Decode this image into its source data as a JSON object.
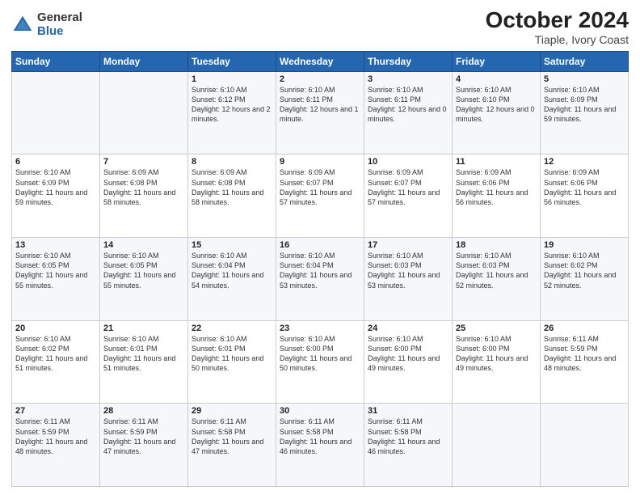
{
  "header": {
    "logo_general": "General",
    "logo_blue": "Blue",
    "title": "October 2024",
    "subtitle": "Tiaple, Ivory Coast"
  },
  "columns": [
    "Sunday",
    "Monday",
    "Tuesday",
    "Wednesday",
    "Thursday",
    "Friday",
    "Saturday"
  ],
  "weeks": [
    [
      {
        "day": "",
        "sunrise": "",
        "sunset": "",
        "daylight": ""
      },
      {
        "day": "",
        "sunrise": "",
        "sunset": "",
        "daylight": ""
      },
      {
        "day": "1",
        "sunrise": "Sunrise: 6:10 AM",
        "sunset": "Sunset: 6:12 PM",
        "daylight": "Daylight: 12 hours and 2 minutes."
      },
      {
        "day": "2",
        "sunrise": "Sunrise: 6:10 AM",
        "sunset": "Sunset: 6:11 PM",
        "daylight": "Daylight: 12 hours and 1 minute."
      },
      {
        "day": "3",
        "sunrise": "Sunrise: 6:10 AM",
        "sunset": "Sunset: 6:11 PM",
        "daylight": "Daylight: 12 hours and 0 minutes."
      },
      {
        "day": "4",
        "sunrise": "Sunrise: 6:10 AM",
        "sunset": "Sunset: 6:10 PM",
        "daylight": "Daylight: 12 hours and 0 minutes."
      },
      {
        "day": "5",
        "sunrise": "Sunrise: 6:10 AM",
        "sunset": "Sunset: 6:09 PM",
        "daylight": "Daylight: 11 hours and 59 minutes."
      }
    ],
    [
      {
        "day": "6",
        "sunrise": "Sunrise: 6:10 AM",
        "sunset": "Sunset: 6:09 PM",
        "daylight": "Daylight: 11 hours and 59 minutes."
      },
      {
        "day": "7",
        "sunrise": "Sunrise: 6:09 AM",
        "sunset": "Sunset: 6:08 PM",
        "daylight": "Daylight: 11 hours and 58 minutes."
      },
      {
        "day": "8",
        "sunrise": "Sunrise: 6:09 AM",
        "sunset": "Sunset: 6:08 PM",
        "daylight": "Daylight: 11 hours and 58 minutes."
      },
      {
        "day": "9",
        "sunrise": "Sunrise: 6:09 AM",
        "sunset": "Sunset: 6:07 PM",
        "daylight": "Daylight: 11 hours and 57 minutes."
      },
      {
        "day": "10",
        "sunrise": "Sunrise: 6:09 AM",
        "sunset": "Sunset: 6:07 PM",
        "daylight": "Daylight: 11 hours and 57 minutes."
      },
      {
        "day": "11",
        "sunrise": "Sunrise: 6:09 AM",
        "sunset": "Sunset: 6:06 PM",
        "daylight": "Daylight: 11 hours and 56 minutes."
      },
      {
        "day": "12",
        "sunrise": "Sunrise: 6:09 AM",
        "sunset": "Sunset: 6:06 PM",
        "daylight": "Daylight: 11 hours and 56 minutes."
      }
    ],
    [
      {
        "day": "13",
        "sunrise": "Sunrise: 6:10 AM",
        "sunset": "Sunset: 6:05 PM",
        "daylight": "Daylight: 11 hours and 55 minutes."
      },
      {
        "day": "14",
        "sunrise": "Sunrise: 6:10 AM",
        "sunset": "Sunset: 6:05 PM",
        "daylight": "Daylight: 11 hours and 55 minutes."
      },
      {
        "day": "15",
        "sunrise": "Sunrise: 6:10 AM",
        "sunset": "Sunset: 6:04 PM",
        "daylight": "Daylight: 11 hours and 54 minutes."
      },
      {
        "day": "16",
        "sunrise": "Sunrise: 6:10 AM",
        "sunset": "Sunset: 6:04 PM",
        "daylight": "Daylight: 11 hours and 53 minutes."
      },
      {
        "day": "17",
        "sunrise": "Sunrise: 6:10 AM",
        "sunset": "Sunset: 6:03 PM",
        "daylight": "Daylight: 11 hours and 53 minutes."
      },
      {
        "day": "18",
        "sunrise": "Sunrise: 6:10 AM",
        "sunset": "Sunset: 6:03 PM",
        "daylight": "Daylight: 11 hours and 52 minutes."
      },
      {
        "day": "19",
        "sunrise": "Sunrise: 6:10 AM",
        "sunset": "Sunset: 6:02 PM",
        "daylight": "Daylight: 11 hours and 52 minutes."
      }
    ],
    [
      {
        "day": "20",
        "sunrise": "Sunrise: 6:10 AM",
        "sunset": "Sunset: 6:02 PM",
        "daylight": "Daylight: 11 hours and 51 minutes."
      },
      {
        "day": "21",
        "sunrise": "Sunrise: 6:10 AM",
        "sunset": "Sunset: 6:01 PM",
        "daylight": "Daylight: 11 hours and 51 minutes."
      },
      {
        "day": "22",
        "sunrise": "Sunrise: 6:10 AM",
        "sunset": "Sunset: 6:01 PM",
        "daylight": "Daylight: 11 hours and 50 minutes."
      },
      {
        "day": "23",
        "sunrise": "Sunrise: 6:10 AM",
        "sunset": "Sunset: 6:00 PM",
        "daylight": "Daylight: 11 hours and 50 minutes."
      },
      {
        "day": "24",
        "sunrise": "Sunrise: 6:10 AM",
        "sunset": "Sunset: 6:00 PM",
        "daylight": "Daylight: 11 hours and 49 minutes."
      },
      {
        "day": "25",
        "sunrise": "Sunrise: 6:10 AM",
        "sunset": "Sunset: 6:00 PM",
        "daylight": "Daylight: 11 hours and 49 minutes."
      },
      {
        "day": "26",
        "sunrise": "Sunrise: 6:11 AM",
        "sunset": "Sunset: 5:59 PM",
        "daylight": "Daylight: 11 hours and 48 minutes."
      }
    ],
    [
      {
        "day": "27",
        "sunrise": "Sunrise: 6:11 AM",
        "sunset": "Sunset: 5:59 PM",
        "daylight": "Daylight: 11 hours and 48 minutes."
      },
      {
        "day": "28",
        "sunrise": "Sunrise: 6:11 AM",
        "sunset": "Sunset: 5:59 PM",
        "daylight": "Daylight: 11 hours and 47 minutes."
      },
      {
        "day": "29",
        "sunrise": "Sunrise: 6:11 AM",
        "sunset": "Sunset: 5:58 PM",
        "daylight": "Daylight: 11 hours and 47 minutes."
      },
      {
        "day": "30",
        "sunrise": "Sunrise: 6:11 AM",
        "sunset": "Sunset: 5:58 PM",
        "daylight": "Daylight: 11 hours and 46 minutes."
      },
      {
        "day": "31",
        "sunrise": "Sunrise: 6:11 AM",
        "sunset": "Sunset: 5:58 PM",
        "daylight": "Daylight: 11 hours and 46 minutes."
      },
      {
        "day": "",
        "sunrise": "",
        "sunset": "",
        "daylight": ""
      },
      {
        "day": "",
        "sunrise": "",
        "sunset": "",
        "daylight": ""
      }
    ]
  ]
}
